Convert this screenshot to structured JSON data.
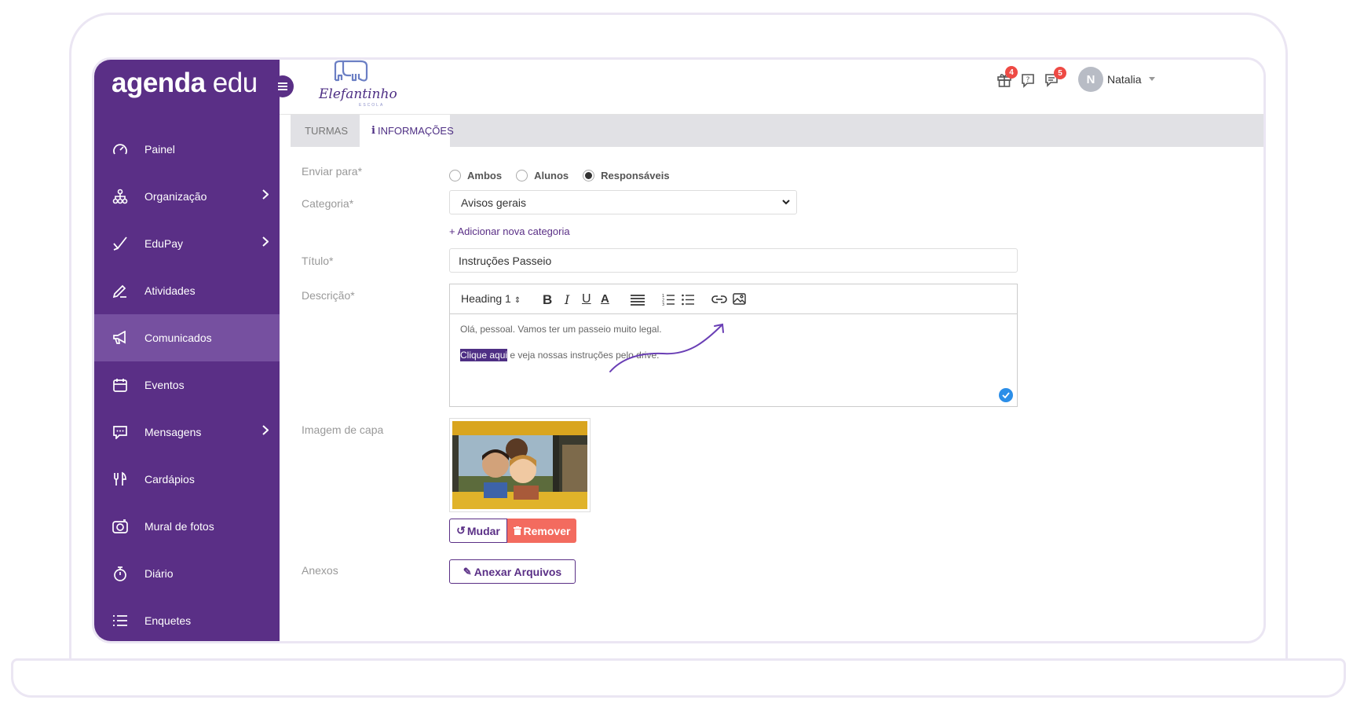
{
  "brand": {
    "bold": "agenda",
    "light": "edu"
  },
  "school": {
    "name": "Elefantinho",
    "subtitle": "ESCOLA"
  },
  "sidebar": {
    "items": [
      {
        "label": "Painel",
        "icon": "gauge-icon"
      },
      {
        "label": "Organização",
        "icon": "org-chart-icon",
        "has_submenu": true
      },
      {
        "label": "EduPay",
        "icon": "check-pen-icon",
        "has_submenu": true
      },
      {
        "label": "Atividades",
        "icon": "pencil-icon"
      },
      {
        "label": "Comunicados",
        "icon": "megaphone-icon",
        "active": true
      },
      {
        "label": "Eventos",
        "icon": "calendar-icon"
      },
      {
        "label": "Mensagens",
        "icon": "chat-icon",
        "has_submenu": true
      },
      {
        "label": "Cardápios",
        "icon": "cutlery-icon"
      },
      {
        "label": "Mural de fotos",
        "icon": "camera-icon"
      },
      {
        "label": "Diário",
        "icon": "stopwatch-icon"
      },
      {
        "label": "Enquetes",
        "icon": "list-icon"
      }
    ]
  },
  "header": {
    "gift_badge": "4",
    "chat_badge": "5",
    "avatar_initial": "N",
    "user_name": "Natalia"
  },
  "tabs": [
    {
      "label": "TURMAS",
      "icon": "users-icon"
    },
    {
      "label": "INFORMAÇÕES",
      "icon": "info-icon",
      "active": true
    }
  ],
  "form": {
    "send_to": {
      "label": "Enviar para*",
      "options": [
        "Ambos",
        "Alunos",
        "Responsáveis"
      ],
      "selected": "Responsáveis"
    },
    "category": {
      "label": "Categoria*",
      "value": "Avisos gerais",
      "add_link": "+ Adicionar nova categoria"
    },
    "title": {
      "label": "Título*",
      "value": "Instruções Passeio"
    },
    "description": {
      "label": "Descrição*",
      "heading_select": "Heading 1",
      "line1": "Olá, pessoal. Vamos ter um passeio muito legal.",
      "link_text": "Clique aqui",
      "line2_rest": " e veja nossas instruções pelo drive."
    },
    "cover": {
      "label": "Imagem de capa",
      "change_label": "Mudar",
      "remove_label": "Remover"
    },
    "attachments": {
      "label": "Anexos",
      "button_label": "Anexar Arquivos"
    }
  },
  "colors": {
    "primary": "#5a2f86",
    "active_item": "#7650a0",
    "danger": "#f36b5f",
    "badge": "#ee4a44"
  }
}
